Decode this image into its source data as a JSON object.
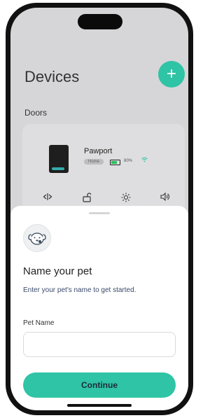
{
  "header": {
    "title": "Devices",
    "add_label": "+"
  },
  "section_label": "Doors",
  "device": {
    "name": "Pawport",
    "location_badge": "Home",
    "battery_percent": "80%",
    "wifi_icon": "‚"
  },
  "controls": [
    "◂▸",
    "⌂",
    "☀",
    "◁)"
  ],
  "sheet": {
    "title": "Name your pet",
    "subtitle": "Enter your pet's name to get started.",
    "field_label": "Pet Name",
    "input_value": "",
    "input_placeholder": "",
    "continue_label": "Continue"
  },
  "colors": {
    "accent": "#2ec4a5",
    "sheet_bg": "#ffffff",
    "dim_bg": "#d6d6d8"
  }
}
